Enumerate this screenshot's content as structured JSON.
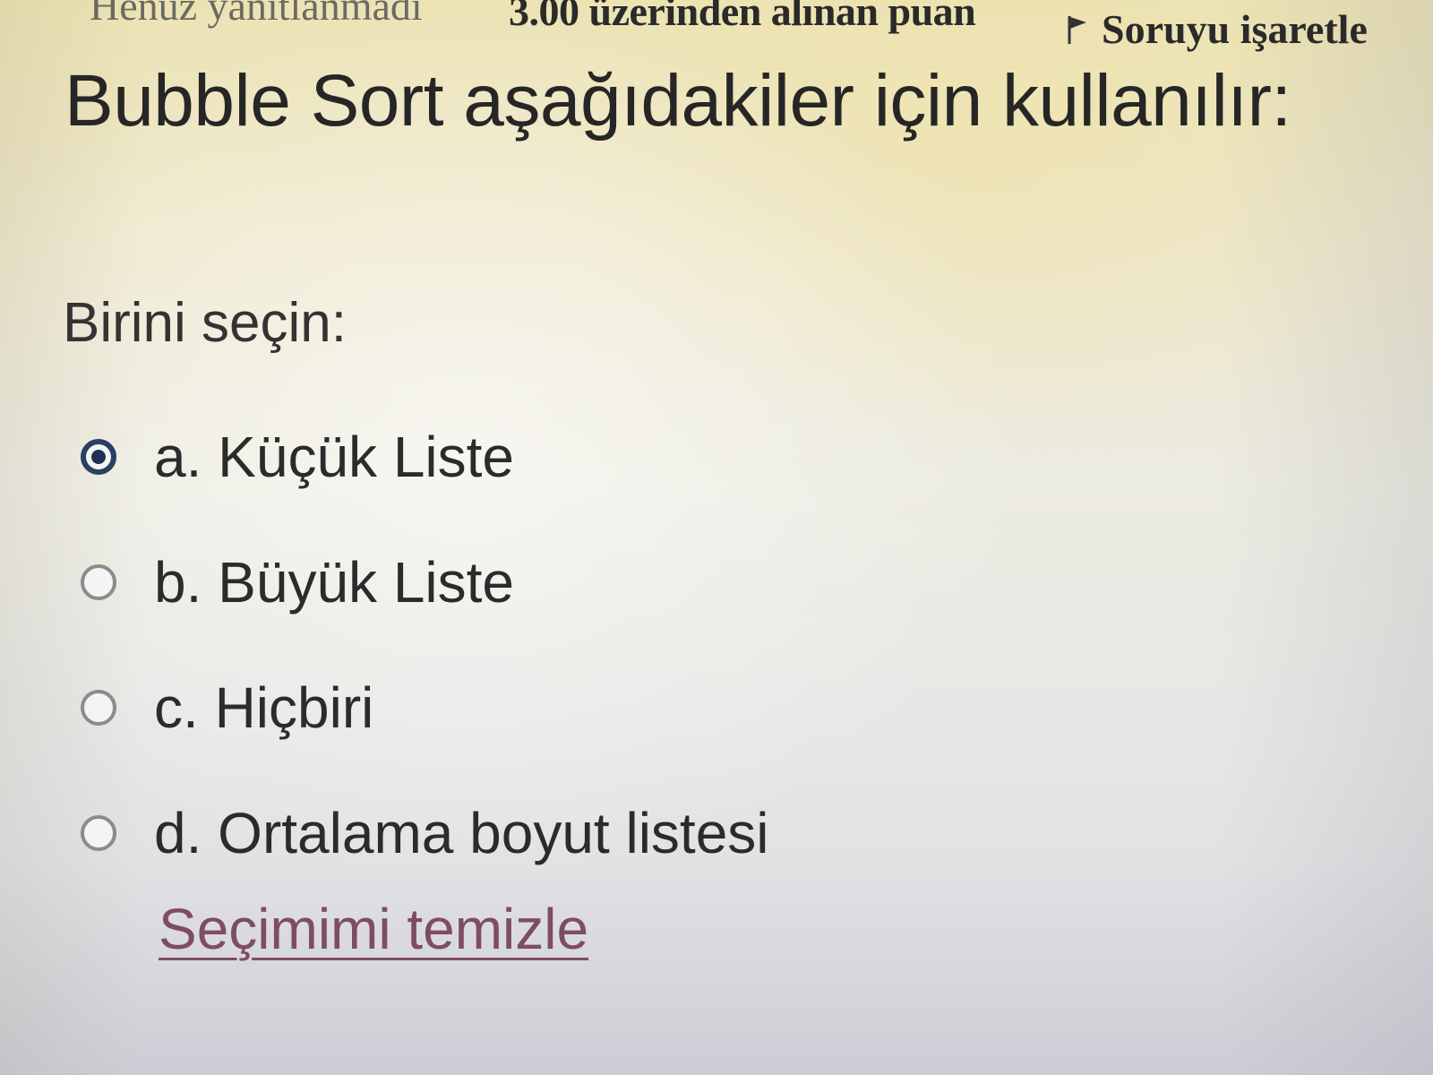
{
  "info": {
    "state": "Henüz yanıtlanmadı",
    "grade": "3.00 üzerinden alınan puan",
    "flag_label": "Soruyu işaretle"
  },
  "question": {
    "text": "Bubble Sort aşağıdakiler için kullanılır:"
  },
  "prompt": "Birini seçin:",
  "answers": [
    {
      "label": "a. Küçük Liste",
      "selected": true
    },
    {
      "label": "b. Büyük Liste",
      "selected": false
    },
    {
      "label": "c. Hiçbiri",
      "selected": false
    },
    {
      "label": "d. Ortalama boyut listesi",
      "selected": false
    }
  ],
  "clear_link": "Seçimimi temizle",
  "icons": {
    "flag": "flag-icon",
    "radio_selected": "radio-checked-icon",
    "radio_unselected": "radio-unchecked-icon"
  },
  "colors": {
    "radio_selected": "#1e3154",
    "link": "#7e4d63"
  }
}
